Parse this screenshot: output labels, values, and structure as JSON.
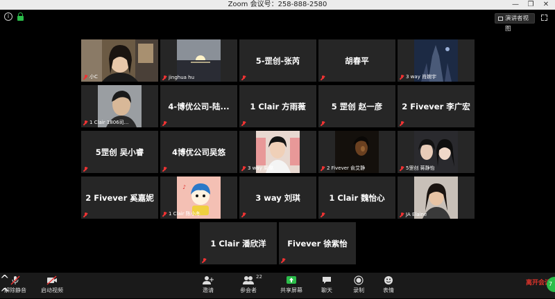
{
  "window": {
    "title": "Zoom 会议号：258-888-2580",
    "controls": [
      "—",
      "❐",
      "✕"
    ]
  },
  "top_right": {
    "speaker_view_label": "演讲者视图"
  },
  "participants": [
    {
      "display": "video",
      "label": "小C",
      "active": true
    },
    {
      "display": "video",
      "label": "jinghua hu"
    },
    {
      "display": "name",
      "name": "5-罡创-张芮"
    },
    {
      "display": "name",
      "name": "胡春平"
    },
    {
      "display": "video",
      "label": "3 way 肖婉宇"
    },
    {
      "display": "video",
      "label": "1 Clair 1806司..."
    },
    {
      "display": "name",
      "name": "4-博优公司-陆..."
    },
    {
      "display": "name",
      "name": "1 Clair 方雨薇"
    },
    {
      "display": "name",
      "name": "5 罡创 赵一彦"
    },
    {
      "display": "name",
      "name": "2 Fivever 李广宏"
    },
    {
      "display": "name",
      "name": "5罡创 吴小睿"
    },
    {
      "display": "name",
      "name": "4博优公司吴悠"
    },
    {
      "display": "video",
      "label": "3 way 周璐"
    },
    {
      "display": "video",
      "label": "2 Fivever 俞艾静"
    },
    {
      "display": "video",
      "label": "5罡创 蒋静怡"
    },
    {
      "display": "name",
      "name": "2 Fivever 奚嘉妮"
    },
    {
      "display": "video",
      "label": "1 Clair 陈小冬"
    },
    {
      "display": "name",
      "name": "3 way 刘琪"
    },
    {
      "display": "name",
      "name": "1 Clair 魏怡心"
    },
    {
      "display": "video",
      "label": "JA Elaine"
    },
    {
      "display": "name",
      "name": "1 Clair 潘欣洋"
    },
    {
      "display": "name",
      "name": "Fivever 徐紫怡"
    }
  ],
  "toolbar": {
    "unmute_label": "解除静音",
    "start_video_label": "启动视频",
    "invite_label": "邀请",
    "participants_label": "参会者",
    "participants_count": "22",
    "share_label": "共享屏幕",
    "chat_label": "聊天",
    "record_label": "录制",
    "reactions_label": "表情",
    "end_label": "离开会议",
    "caret": "^"
  },
  "colors": {
    "active_speaker": "#c8e84a",
    "muted": "#e33333",
    "share_green": "#2bbd4a",
    "end_red": "#e0342b"
  }
}
